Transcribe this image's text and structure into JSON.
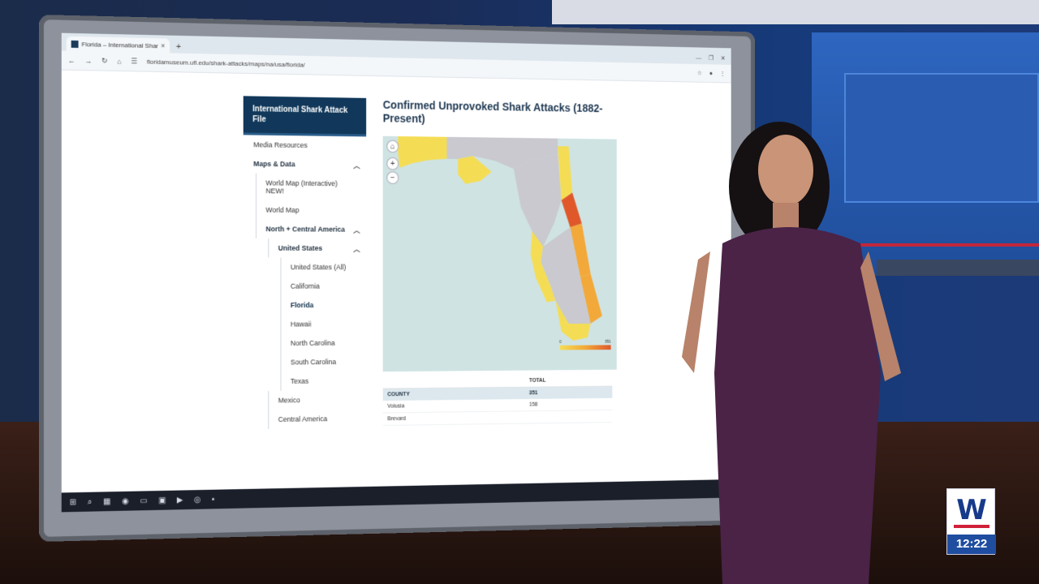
{
  "browser": {
    "tab_title": "Florida – International Shark At",
    "tab_close": "×",
    "new_tab": "+",
    "url": "floridamuseum.ufl.edu/shark-attacks/maps/na/usa/florida/"
  },
  "sidebar": {
    "header": "International Shark Attack File",
    "items": [
      {
        "label": "Media Resources"
      },
      {
        "label": "Maps & Data"
      },
      {
        "label": "World Map (Interactive) NEW!"
      },
      {
        "label": "World Map"
      },
      {
        "label": "North + Central America"
      },
      {
        "label": "United States"
      },
      {
        "label": "United States (All)"
      },
      {
        "label": "California"
      },
      {
        "label": "Florida"
      },
      {
        "label": "Hawaii"
      },
      {
        "label": "North Carolina"
      },
      {
        "label": "South Carolina"
      },
      {
        "label": "Texas"
      },
      {
        "label": "Mexico"
      },
      {
        "label": "Central America"
      }
    ]
  },
  "main": {
    "title": "Confirmed Unprovoked Shark Attacks (1882-Present)",
    "legend_min": "0",
    "legend_max": "351",
    "table": {
      "header_total": "TOTAL",
      "subheader_county": "COUNTY",
      "subheader_value": "351",
      "rows": [
        {
          "county": "Volusia",
          "total": "158"
        },
        {
          "county": "Brevard",
          "total": ""
        }
      ]
    }
  },
  "colors": {
    "sidebar_header": "#11385a",
    "map_water": "#cfe3e3",
    "low": "#f4dd55",
    "mid": "#f2a93a",
    "high": "#e0582a",
    "no_data": "#c9c9cf"
  },
  "overlay": {
    "logo_letter": "W",
    "clock": "12:22"
  }
}
